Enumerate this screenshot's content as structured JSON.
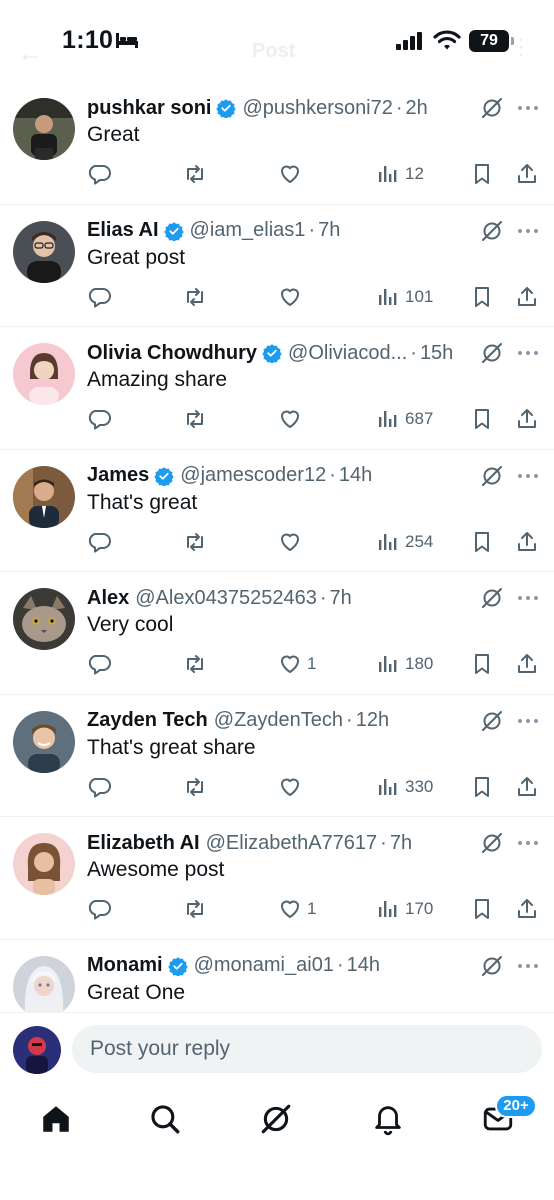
{
  "status_bar": {
    "time": "1:10",
    "battery": "79"
  },
  "header": {
    "title": "Post"
  },
  "colors": {
    "accent": "#1d9bf0",
    "text": "#0f1419",
    "secondary": "#536471"
  },
  "replies": [
    {
      "name": "pushkar soni",
      "verified": true,
      "handle": "@pushkersoni72",
      "time": "2h",
      "text": "Great",
      "likes": "",
      "views": "12"
    },
    {
      "name": "Elias AI",
      "verified": true,
      "handle": "@iam_elias1",
      "time": "7h",
      "text": "Great post",
      "likes": "",
      "views": "101"
    },
    {
      "name": "Olivia Chowdhury",
      "verified": true,
      "handle": "@Oliviacod...",
      "time": "15h",
      "text": "Amazing share",
      "likes": "",
      "views": "687"
    },
    {
      "name": "James",
      "verified": true,
      "handle": "@jamescoder12",
      "time": "14h",
      "text": "That's great",
      "likes": "",
      "views": "254"
    },
    {
      "name": "Alex",
      "verified": false,
      "handle": "@Alex04375252463",
      "time": "7h",
      "text": "Very cool",
      "likes": "1",
      "views": "180"
    },
    {
      "name": "Zayden Tech",
      "verified": false,
      "handle": "@ZaydenTech",
      "time": "12h",
      "text": "That's great share",
      "likes": "",
      "views": "330"
    },
    {
      "name": "Elizabeth AI",
      "verified": false,
      "handle": "@ElizabethA77617",
      "time": "7h",
      "text": "Awesome post",
      "likes": "1",
      "views": "170"
    },
    {
      "name": "Monami",
      "verified": true,
      "handle": "@monami_ai01",
      "time": "14h",
      "text": "Great One",
      "likes": "",
      "views": ""
    }
  ],
  "composer": {
    "placeholder": "Post your reply"
  },
  "tab_bar": {
    "items": [
      "home-icon",
      "search-icon",
      "grok-icon",
      "bell-icon",
      "mail-icon"
    ],
    "messages_badge": "20+"
  }
}
